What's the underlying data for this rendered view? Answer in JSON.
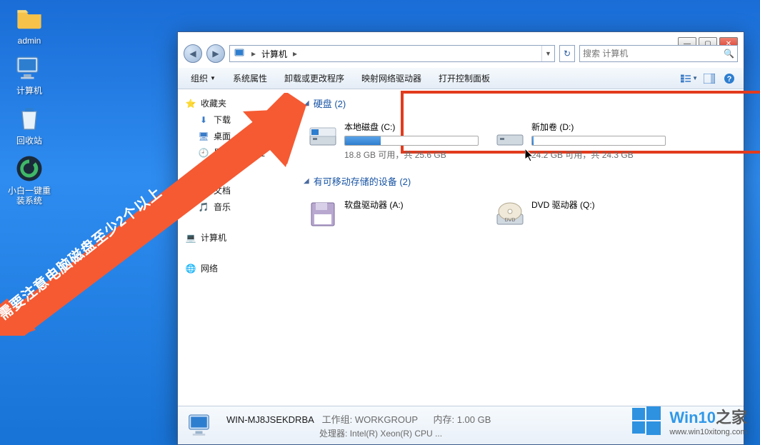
{
  "desktop": {
    "icons": [
      {
        "label": "admin",
        "icon": "folder-icon"
      },
      {
        "label": "计算机",
        "icon": "computer-icon"
      },
      {
        "label": "回收站",
        "icon": "recycle-bin-icon"
      },
      {
        "label": "小白一键重\n装系统",
        "icon": "reinstall-icon"
      }
    ]
  },
  "window": {
    "breadcrumb": {
      "seg1": "计算机"
    },
    "search_placeholder": "搜索 计算机",
    "toolbar": {
      "organize": "组织",
      "sys_props": "系统属性",
      "uninstall": "卸载或更改程序",
      "map_drive": "映射网络驱动器",
      "control_panel": "打开控制面板"
    },
    "sidebar": {
      "favorites": "收藏夹",
      "downloads": "下载",
      "desktop": "桌面",
      "recent": "最近访问的位",
      "docs": "文档",
      "music": "音乐",
      "computer": "计算机",
      "network": "网络"
    },
    "content": {
      "group_disks": "硬盘 (2)",
      "drive_c": {
        "name": "本地磁盘 (C:)",
        "meta": "18.8 GB 可用，共 25.6 GB",
        "fill_pct": 27
      },
      "drive_d": {
        "name": "新加卷 (D:)",
        "meta": "24.2 GB 可用，共 24.3 GB",
        "fill_pct": 1
      },
      "group_removable": "有可移动存储的设备 (2)",
      "floppy": "软盘驱动器 (A:)",
      "dvd": "DVD 驱动器 (Q:)"
    },
    "details": {
      "line1_name": "WIN-MJ8JSEKDRBA",
      "line1_wg_label": "工作组:",
      "line1_wg": "WORKGROUP",
      "line1_mem_label": "内存:",
      "line1_mem": "1.00 GB",
      "line2_label": "处理器:",
      "line2_val": "Intel(R) Xeon(R) CPU ..."
    }
  },
  "annotation_text": "需要注意电脑磁盘至少2个以上",
  "watermark": {
    "brand_a": "Win10",
    "brand_b": "之家",
    "url": "www.win10xitong.com"
  }
}
